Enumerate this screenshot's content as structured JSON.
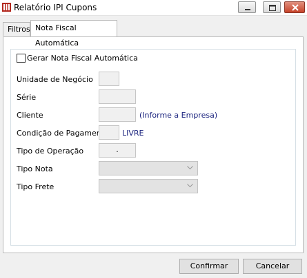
{
  "window": {
    "title": "Relatório IPI Cupons"
  },
  "tabs": [
    {
      "label": "Filtros"
    },
    {
      "label": "Nota Fiscal Automática"
    }
  ],
  "form": {
    "auto_nf_label": "Gerar Nota Fiscal Automática",
    "auto_nf_checked": false,
    "unidade_label": "Unidade de Negócio",
    "serie_label": "Série",
    "cliente_label": "Cliente",
    "cliente_hint": "(Informe a Empresa)",
    "condicao_label": "Condição de Pagamento",
    "condicao_value": "LIVRE",
    "tipo_operacao_label": "Tipo de Operação",
    "tipo_operacao_value": ".",
    "tipo_nota_label": "Tipo Nota",
    "tipo_frete_label": "Tipo Frete"
  },
  "buttons": {
    "confirm": "Confirmar",
    "cancel": "Cancelar"
  },
  "colors": {
    "hint": "#1a237e",
    "close_button": "#c7432a"
  }
}
